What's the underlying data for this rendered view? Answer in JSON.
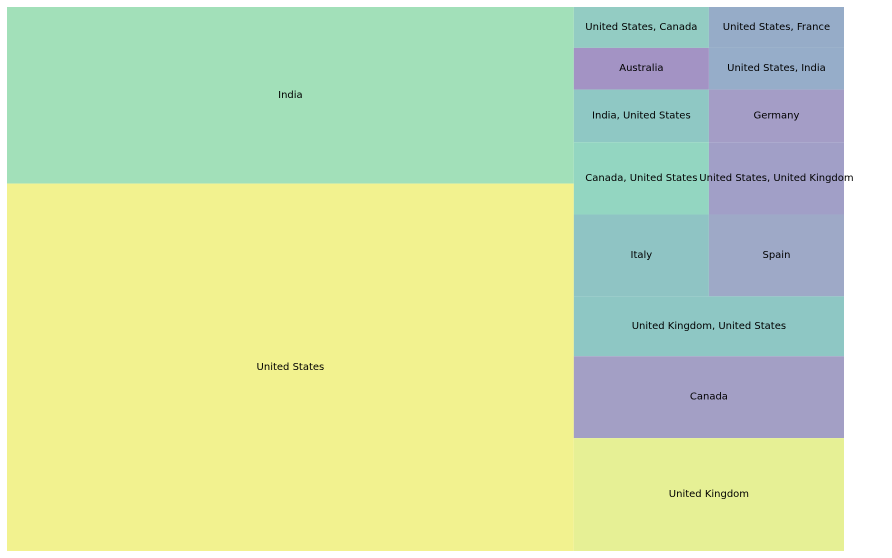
{
  "chart_data": {
    "type": "treemap",
    "title": "",
    "total": 4630,
    "items": [
      {
        "label": "United States",
        "value": 2110,
        "color": "#f2f28f"
      },
      {
        "label": "India",
        "value": 1014,
        "color": "#a2e0b9"
      },
      {
        "label": "United Kingdom",
        "value": 309,
        "color": "#e6f095"
      },
      {
        "label": "Canada",
        "value": 224,
        "color": "#a39fc5"
      },
      {
        "label": "United Kingdom, United States",
        "value": 164,
        "color": "#8ec7c4"
      },
      {
        "label": "Spain",
        "value": 112,
        "color": "#9ea9c7"
      },
      {
        "label": "Italy",
        "value": 112,
        "color": "#8fc4c4"
      },
      {
        "label": "Canada, United States",
        "value": 99,
        "color": "#93d6c1"
      },
      {
        "label": "United States, United Kingdom",
        "value": 99,
        "color": "#a19fc7"
      },
      {
        "label": "India, United States",
        "value": 72,
        "color": "#8fc8c4"
      },
      {
        "label": "Germany",
        "value": 72,
        "color": "#a49dc6"
      },
      {
        "label": "Australia",
        "value": 57,
        "color": "#a393c4"
      },
      {
        "label": "United States, India",
        "value": 57,
        "color": "#96adc9"
      },
      {
        "label": "United States, Canada",
        "value": 56,
        "color": "#93ccc3"
      },
      {
        "label": "United States, France",
        "value": 56,
        "color": "#96acc8"
      }
    ]
  }
}
